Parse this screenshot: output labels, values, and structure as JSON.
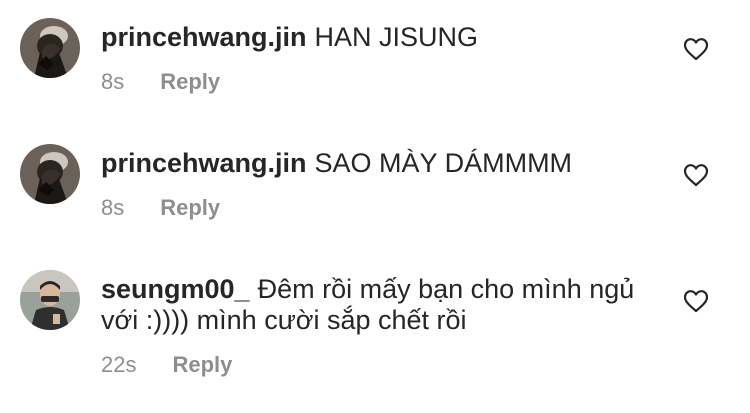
{
  "comments": [
    {
      "username": "princehwang.jin",
      "text": "HAN JISUNG",
      "time": "8s",
      "reply_label": "Reply",
      "avatar_icon": "avatar-photo-dark",
      "like_icon": "heart-outline-icon"
    },
    {
      "username": "princehwang.jin",
      "text": "SAO MÀY DÁMMMM",
      "time": "8s",
      "reply_label": "Reply",
      "avatar_icon": "avatar-photo-dark",
      "like_icon": "heart-outline-icon"
    },
    {
      "username": "seungm00_",
      "text": "Đêm rồi mấy bạn cho mình ngủ với :)))) mình cười sắp chết rồi",
      "time": "22s",
      "reply_label": "Reply",
      "avatar_icon": "avatar-photo-person",
      "like_icon": "heart-outline-icon"
    }
  ],
  "colors": {
    "text": "#262626",
    "secondary": "#8e8e8e",
    "background": "#ffffff"
  }
}
